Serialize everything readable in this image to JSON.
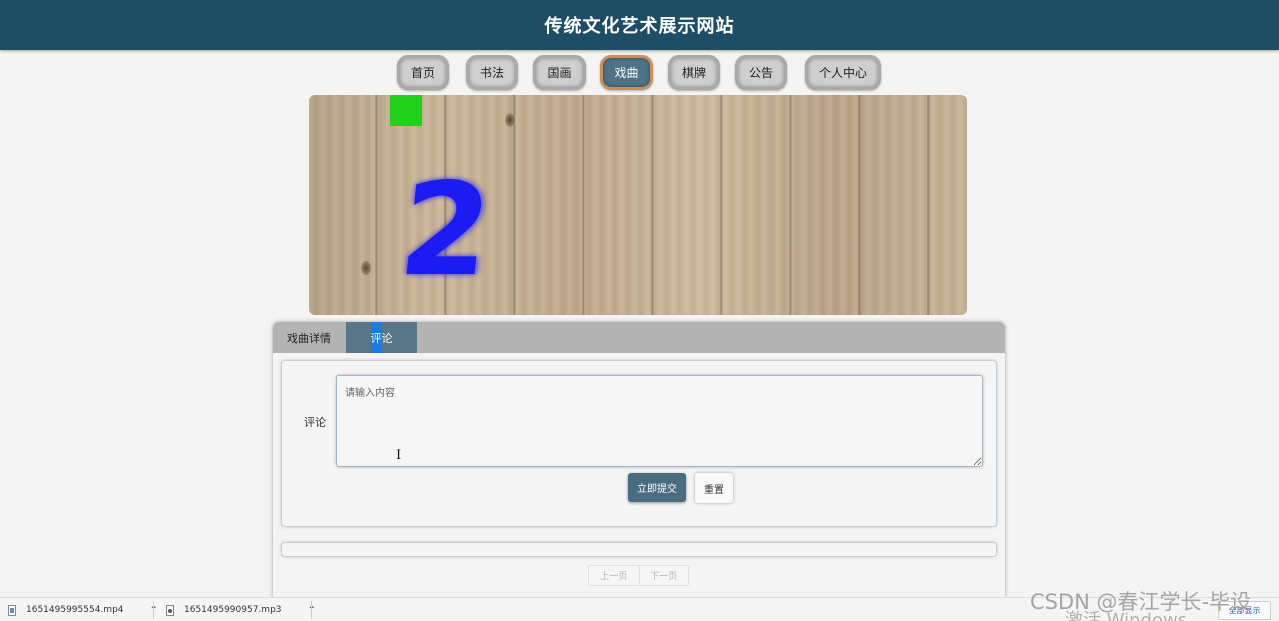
{
  "header": {
    "title": "传统文化艺术展示网站"
  },
  "nav": {
    "items": [
      {
        "label": "首页"
      },
      {
        "label": "书法"
      },
      {
        "label": "国画"
      },
      {
        "label": "戏曲"
      },
      {
        "label": "棋牌"
      },
      {
        "label": "公告"
      },
      {
        "label": "个人中心"
      }
    ],
    "active": "戏曲"
  },
  "banner": {
    "slide_number": "2",
    "colors": {
      "marker": "#22d11b",
      "number": "#1c1cf2"
    }
  },
  "tabs": {
    "details_label": "戏曲详情",
    "comments_label": "评论"
  },
  "comment_form": {
    "field_label": "评论",
    "placeholder": "请输入内容",
    "value": "",
    "submit_label": "立即提交",
    "reset_label": "重置"
  },
  "pagination": {
    "prev_label": "上一页",
    "next_label": "下一页"
  },
  "downloads": {
    "items": [
      {
        "file": "1651495995554.mp4",
        "icon": "video-file-icon"
      },
      {
        "file": "1651495990957.mp3",
        "icon": "audio-file-icon"
      }
    ],
    "show_all_label": "全部显示"
  },
  "overlay": {
    "watermark": "CSDN @春江学长-毕设",
    "activate_windows": "激活 Windows"
  },
  "colors": {
    "header_bg": "#1e4d65",
    "active_tab_bg": "#577789",
    "submit_bg": "#4a6c80"
  }
}
